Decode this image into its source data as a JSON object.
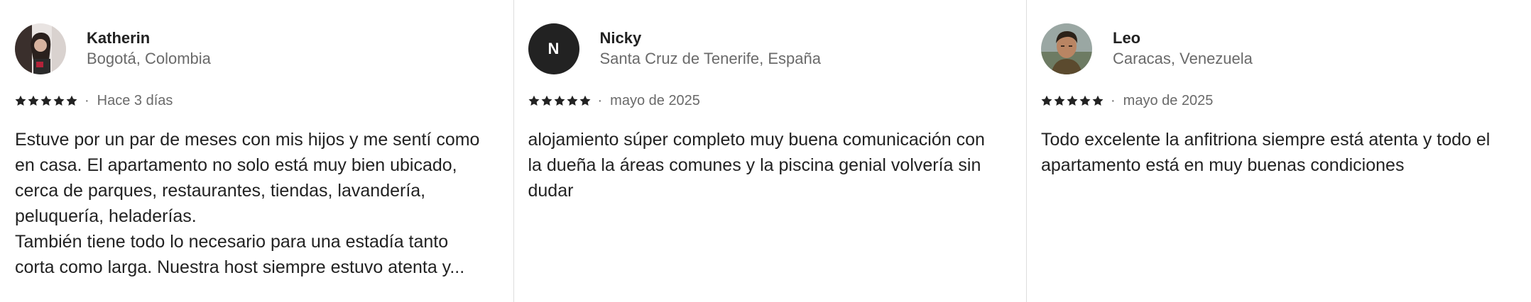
{
  "colors": {
    "text": "#222222",
    "muted": "#6a6a6a",
    "divider": "#dddddd",
    "star": "#222222"
  },
  "reviews": [
    {
      "name": "Katherin",
      "location": "Bogotá, Colombia",
      "avatar": {
        "type": "photo",
        "icon": "user-photo-icon"
      },
      "rating": 5,
      "date": "Hace 3 días",
      "text": "Estuve por un par de meses con mis hijos y me sentí como\nen casa. El apartamento no solo está muy bien ubicado,\ncerca de parques, restaurantes, tiendas, lavandería,\npeluquería, heladerías.\nTambién tiene todo lo necesario para una estadía tanto\ncorta como larga. Nuestra host siempre estuvo atenta y..."
    },
    {
      "name": "Nicky",
      "location": "Santa Cruz de Tenerife, España",
      "avatar": {
        "type": "initial",
        "initial": "N"
      },
      "rating": 5,
      "date": "mayo de 2025",
      "text": "alojamiento súper completo muy buena comunicación con\nla dueña la áreas comunes y la piscina genial volvería sin\ndudar"
    },
    {
      "name": "Leo",
      "location": "Caracas, Venezuela",
      "avatar": {
        "type": "photo",
        "icon": "user-photo-icon"
      },
      "rating": 5,
      "date": "mayo de 2025",
      "text": "Todo excelente la anfitriona siempre está atenta y todo el\napartamento está en muy buenas condiciones"
    }
  ],
  "meta_separator": "·"
}
